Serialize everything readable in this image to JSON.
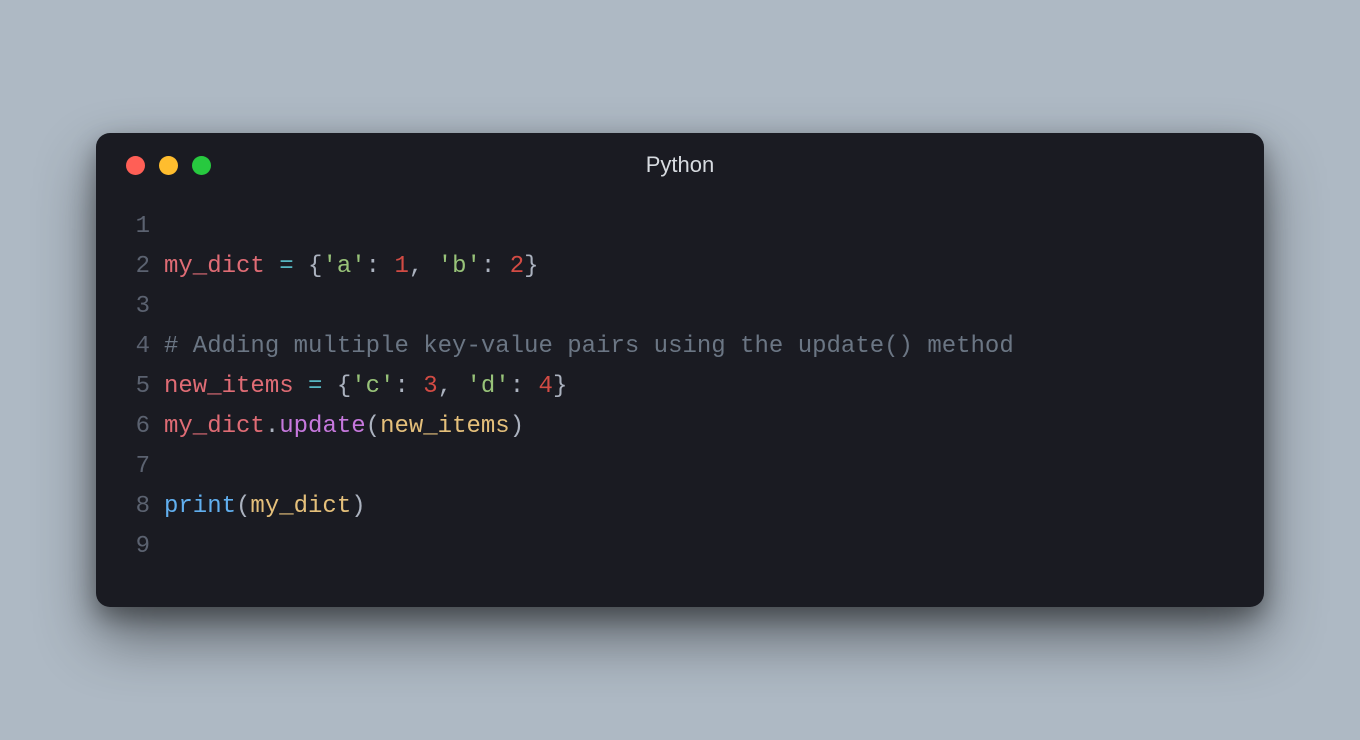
{
  "window": {
    "title": "Python",
    "traffic_lights": {
      "red": "#ff5f56",
      "yellow": "#ffbd2e",
      "green": "#27c93f"
    }
  },
  "code": {
    "lines": [
      {
        "n": 1,
        "tokens": []
      },
      {
        "n": 2,
        "tokens": [
          {
            "t": "my_dict",
            "c": "tok-ident1"
          },
          {
            "t": " ",
            "c": ""
          },
          {
            "t": "=",
            "c": "tok-op"
          },
          {
            "t": " ",
            "c": ""
          },
          {
            "t": "{",
            "c": "tok-punc"
          },
          {
            "t": "'a'",
            "c": "tok-str"
          },
          {
            "t": ":",
            "c": "tok-punc"
          },
          {
            "t": " ",
            "c": ""
          },
          {
            "t": "1",
            "c": "tok-num"
          },
          {
            "t": ",",
            "c": "tok-punc"
          },
          {
            "t": " ",
            "c": ""
          },
          {
            "t": "'b'",
            "c": "tok-str"
          },
          {
            "t": ":",
            "c": "tok-punc"
          },
          {
            "t": " ",
            "c": ""
          },
          {
            "t": "2",
            "c": "tok-num"
          },
          {
            "t": "}",
            "c": "tok-punc"
          }
        ]
      },
      {
        "n": 3,
        "tokens": []
      },
      {
        "n": 4,
        "tokens": [
          {
            "t": "# Adding multiple key-value pairs using the update() method",
            "c": "tok-comment"
          }
        ]
      },
      {
        "n": 5,
        "tokens": [
          {
            "t": "new_items",
            "c": "tok-ident1"
          },
          {
            "t": " ",
            "c": ""
          },
          {
            "t": "=",
            "c": "tok-op"
          },
          {
            "t": " ",
            "c": ""
          },
          {
            "t": "{",
            "c": "tok-punc"
          },
          {
            "t": "'c'",
            "c": "tok-str"
          },
          {
            "t": ":",
            "c": "tok-punc"
          },
          {
            "t": " ",
            "c": ""
          },
          {
            "t": "3",
            "c": "tok-num"
          },
          {
            "t": ",",
            "c": "tok-punc"
          },
          {
            "t": " ",
            "c": ""
          },
          {
            "t": "'d'",
            "c": "tok-str"
          },
          {
            "t": ":",
            "c": "tok-punc"
          },
          {
            "t": " ",
            "c": ""
          },
          {
            "t": "4",
            "c": "tok-num"
          },
          {
            "t": "}",
            "c": "tok-punc"
          }
        ]
      },
      {
        "n": 6,
        "tokens": [
          {
            "t": "my_dict",
            "c": "tok-ident1"
          },
          {
            "t": ".",
            "c": "tok-punc"
          },
          {
            "t": "update",
            "c": "tok-method"
          },
          {
            "t": "(",
            "c": "tok-punc"
          },
          {
            "t": "new_items",
            "c": "tok-ident2"
          },
          {
            "t": ")",
            "c": "tok-punc"
          }
        ]
      },
      {
        "n": 7,
        "tokens": []
      },
      {
        "n": 8,
        "tokens": [
          {
            "t": "print",
            "c": "tok-func"
          },
          {
            "t": "(",
            "c": "tok-punc"
          },
          {
            "t": "my_dict",
            "c": "tok-ident2"
          },
          {
            "t": ")",
            "c": "tok-punc"
          }
        ]
      },
      {
        "n": 9,
        "tokens": []
      }
    ]
  }
}
